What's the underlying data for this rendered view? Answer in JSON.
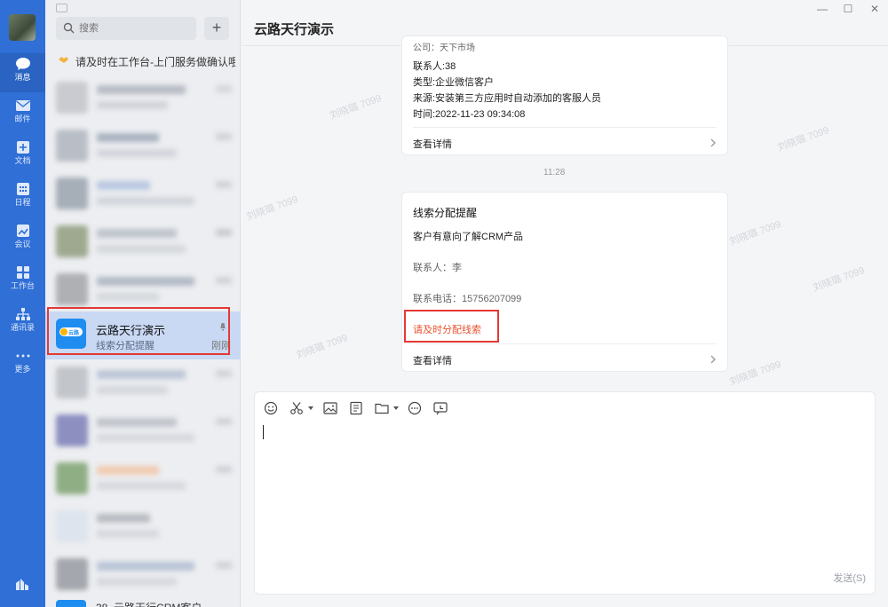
{
  "nav": {
    "items": [
      {
        "label": "消息",
        "icon": "message-icon",
        "active": true
      },
      {
        "label": "邮件",
        "icon": "mail-icon"
      },
      {
        "label": "文档",
        "icon": "document-icon"
      },
      {
        "label": "日程",
        "icon": "calendar-icon"
      },
      {
        "label": "会议",
        "icon": "meeting-icon"
      },
      {
        "label": "工作台",
        "icon": "workbench-icon"
      },
      {
        "label": "通讯录",
        "icon": "contacts-icon"
      },
      {
        "label": "更多",
        "icon": "more-icon"
      }
    ]
  },
  "list": {
    "search_placeholder": "搜索",
    "add_label": "+",
    "pinned_tip": "请及时在工作台-上门服务做确认哦。",
    "selected": {
      "name": "云路天行演示",
      "preview": "线索分配提醒",
      "time": "刚刚",
      "logo_text": "云路"
    },
    "partial": {
      "name": "38_云路天行CRM客户"
    }
  },
  "chat": {
    "title": "云路天行演示",
    "window_controls": {
      "minimize": "—",
      "maximize": "☐",
      "close": "✕"
    },
    "card1": {
      "company_partial": "公司：天下市场",
      "contact": "联系人:38",
      "type": "类型:企业微信客户",
      "source": "来源:安装第三方应用时自动添加的客服人员",
      "time": "时间:2022-11-23 09:34:08",
      "detail": "查看详情"
    },
    "timestamp": "11:28",
    "card2": {
      "title": "线索分配提醒",
      "desc": "客户有意向了解CRM产品",
      "contact": "联系人：李",
      "phone": "联系电话：15756207099",
      "action": "请及时分配线索",
      "detail": "查看详情"
    },
    "watermark": "刘晓璐 7099",
    "send_label": "发送(S)"
  },
  "colors": {
    "nav_bg": "#2f6fd6",
    "accent_link": "#e8532e",
    "highlight_box": "#e53935",
    "selected_row": "#c9d8f3"
  }
}
